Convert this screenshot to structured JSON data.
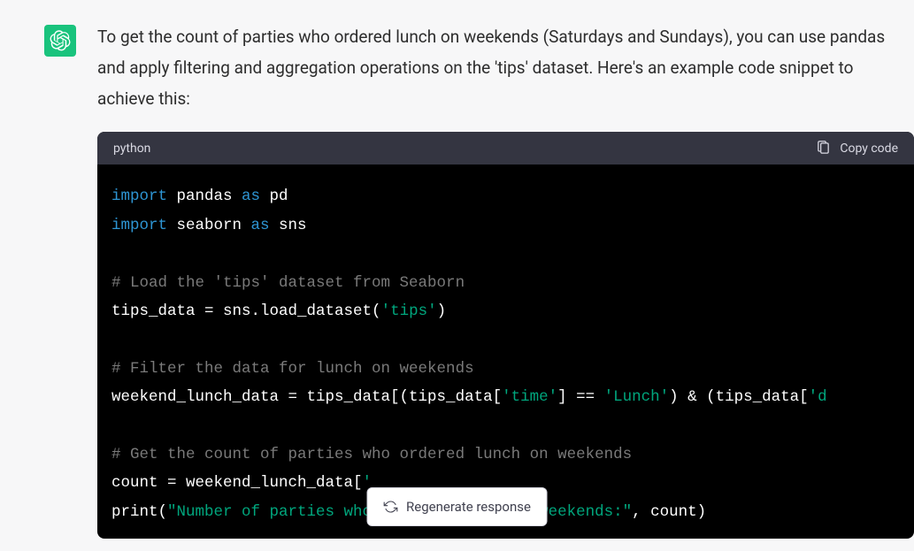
{
  "message": {
    "prose": "To get the count of parties who ordered lunch on weekends (Saturdays and Sundays), you can use pandas and apply filtering and aggregation operations on the 'tips' dataset. Here's an example code snippet to achieve this:"
  },
  "code": {
    "language": "python",
    "copy_label": "Copy code",
    "tokens": {
      "kw_import1": "import",
      "id_pandas": " pandas ",
      "kw_as1": "as",
      "id_pd": " pd",
      "kw_import2": "import",
      "id_seaborn": " seaborn ",
      "kw_as2": "as",
      "id_sns": " sns",
      "cmt_load": "# Load the 'tips' dataset from Seaborn",
      "line_load1": "tips_data = sns.load_dataset(",
      "str_tips": "'tips'",
      "line_load2": ")",
      "cmt_filter": "# Filter the data for lunch on weekends",
      "line_filter1": "weekend_lunch_data = tips_data[(tips_data[",
      "str_time": "'time'",
      "line_filter2": "] == ",
      "str_lunch": "'Lunch'",
      "line_filter3": ") & (tips_data[",
      "str_d": "'d",
      "cmt_count": "# Get the count of parties who ordered lunch on weekends",
      "line_count1": "count = weekend_lunch_data[",
      "str_col": "'",
      "line_print1": "print(",
      "str_print_msg": "\"Number of parties who ordered lunch on weekends:\"",
      "line_print2": ", count)"
    }
  },
  "regenerate_label": "Regenerate response"
}
